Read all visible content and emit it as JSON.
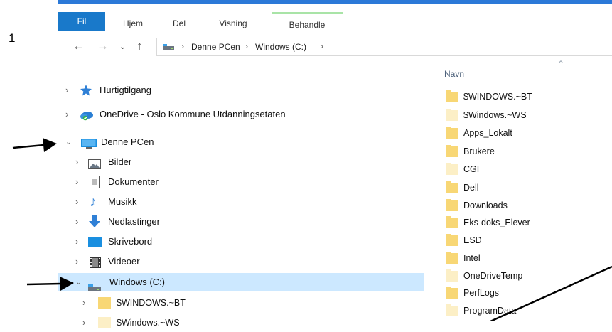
{
  "step_number": "1",
  "ribbon": {
    "tabs": [
      "Fil",
      "Hjem",
      "Del",
      "Visning",
      "Behandle"
    ]
  },
  "address_bar": {
    "breadcrumbs": [
      "Denne PCen",
      "Windows (C:)"
    ],
    "icons": [
      "back-arrow-icon",
      "forward-arrow-icon",
      "recent-chevron-icon",
      "up-arrow-icon",
      "drive-icon"
    ]
  },
  "nav_tree": {
    "items": [
      {
        "label": "Hurtigtilgang",
        "icon": "star-icon",
        "expanded": false
      },
      {
        "label": "OneDrive - Oslo Kommune Utdanningsetaten",
        "icon": "onedrive-cloud-icon",
        "expanded": false
      },
      {
        "label": "Denne PCen",
        "icon": "computer-icon",
        "expanded": true
      },
      {
        "label": "Bilder",
        "icon": "pictures-icon",
        "expanded": false
      },
      {
        "label": "Dokumenter",
        "icon": "documents-icon",
        "expanded": false
      },
      {
        "label": "Musikk",
        "icon": "music-note-icon",
        "expanded": false
      },
      {
        "label": "Nedlastinger",
        "icon": "download-arrow-icon",
        "expanded": false
      },
      {
        "label": "Skrivebord",
        "icon": "desktop-icon",
        "expanded": false
      },
      {
        "label": "Videoer",
        "icon": "film-icon",
        "expanded": false
      },
      {
        "label": "Windows (C:)",
        "icon": "drive-icon",
        "expanded": true,
        "selected": true
      },
      {
        "label": "$WINDOWS.~BT",
        "icon": "folder-icon",
        "expanded": false
      },
      {
        "label": "$Windows.~WS",
        "icon": "folder-icon",
        "expanded": false
      }
    ]
  },
  "file_list": {
    "column_header": "Navn",
    "files": [
      {
        "name": "$WINDOWS.~BT",
        "hidden": false
      },
      {
        "name": "$Windows.~WS",
        "hidden": true
      },
      {
        "name": "Apps_Lokalt",
        "hidden": false
      },
      {
        "name": "Brukere",
        "hidden": false
      },
      {
        "name": "CGI",
        "hidden": true
      },
      {
        "name": "Dell",
        "hidden": false
      },
      {
        "name": "Downloads",
        "hidden": false
      },
      {
        "name": "Eks-doks_Elever",
        "hidden": false
      },
      {
        "name": "ESD",
        "hidden": false
      },
      {
        "name": "Intel",
        "hidden": false
      },
      {
        "name": "OneDriveTemp",
        "hidden": true
      },
      {
        "name": "PerfLogs",
        "hidden": false
      },
      {
        "name": "ProgramData",
        "hidden": true
      }
    ]
  },
  "colors": {
    "accent_blue": "#1979ca",
    "selection_bg": "#cce8ff",
    "manage_tab_green": "#a9e4a7",
    "folder_yellow": "#f8d775",
    "hidden_folder": "#fcefc6"
  }
}
